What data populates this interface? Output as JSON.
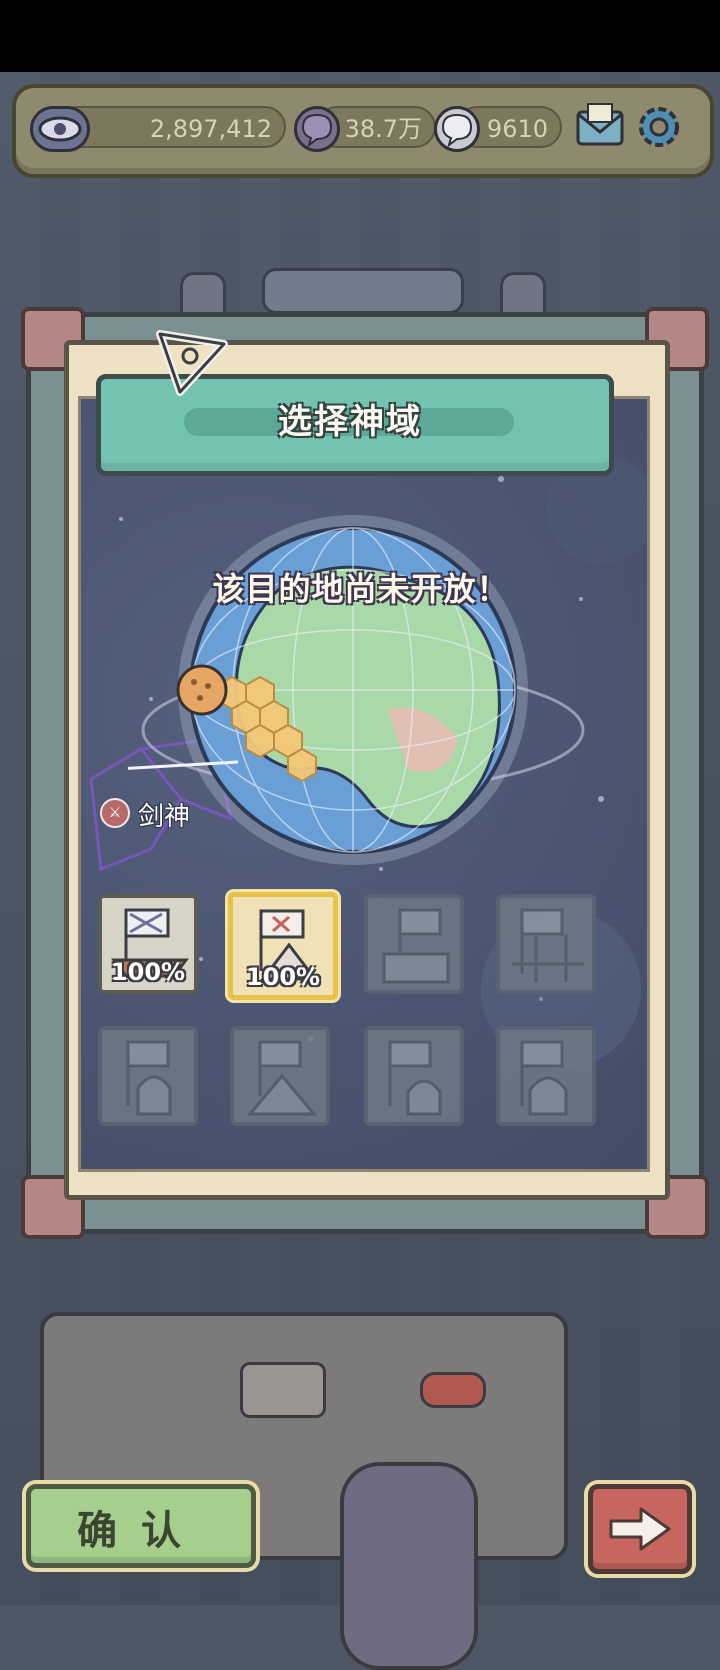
{
  "resources": [
    {
      "icon": "eye-icon",
      "value": "2,897,412"
    },
    {
      "icon": "purple-bubble-icon",
      "value": "38.7万"
    },
    {
      "icon": "white-bubble-icon",
      "value": "9610"
    }
  ],
  "toolbar": {
    "mail_icon": "mail-icon",
    "settings_icon": "gear-icon"
  },
  "panel": {
    "title": "选择神域",
    "message": "该目的地尚未开放！",
    "destination": {
      "name": "剑神",
      "icon": "sword-god-icon"
    }
  },
  "tiles": [
    {
      "name": "ship-flag",
      "progress": "100%",
      "state": "unlocked"
    },
    {
      "name": "mountain-flag",
      "progress": "100%",
      "state": "selected"
    },
    {
      "name": "castle-flag",
      "progress": "",
      "state": "locked"
    },
    {
      "name": "bridge-flag",
      "progress": "",
      "state": "locked"
    },
    {
      "name": "cathedral-flag",
      "progress": "",
      "state": "locked"
    },
    {
      "name": "pyramid-flag",
      "progress": "",
      "state": "locked"
    },
    {
      "name": "mosque-flag",
      "progress": "",
      "state": "locked"
    },
    {
      "name": "palace-flag",
      "progress": "",
      "state": "locked"
    }
  ],
  "buttons": {
    "confirm": "确认",
    "next_icon": "arrow-right-icon"
  },
  "colors": {
    "confirm": "#a6cf8e",
    "next": "#c7655f",
    "banner": "#73c3b3",
    "selected_border": "#e6c24a"
  }
}
